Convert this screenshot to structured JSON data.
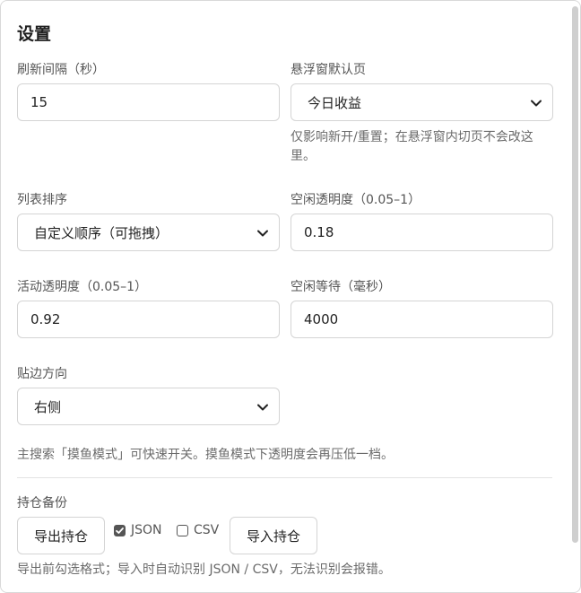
{
  "title": "设置",
  "refresh_interval": {
    "label": "刷新间隔（秒）",
    "value": "15"
  },
  "float_default_page": {
    "label": "悬浮窗默认页",
    "selected": "今日收益",
    "note": "仅影响新开/重置；在悬浮窗内切页不会改这里。"
  },
  "list_sort": {
    "label": "列表排序",
    "selected": "自定义顺序（可拖拽）"
  },
  "idle_opacity": {
    "label": "空闲透明度（0.05–1）",
    "value": "0.18"
  },
  "active_opacity": {
    "label": "活动透明度（0.05–1）",
    "value": "0.92"
  },
  "idle_wait": {
    "label": "空闲等待（毫秒）",
    "value": "4000"
  },
  "dock_side": {
    "label": "贴边方向",
    "selected": "右侧"
  },
  "fish_mode_note": "主搜索「摸鱼模式」可快速开关。摸鱼模式下透明度会再压低一档。",
  "backup": {
    "label": "持仓备份",
    "export_label": "导出持仓",
    "json_label": "JSON",
    "json_checked": true,
    "csv_label": "CSV",
    "csv_checked": false,
    "import_label": "导入持仓",
    "note": "导出前勾选格式；导入时自动识别 JSON / CSV，无法识别会报错。"
  },
  "icons": {
    "select_arrow": "chevron-down-icon",
    "checked_box": "checkbox-checked-icon",
    "unchecked_box": "checkbox-unchecked-icon"
  }
}
